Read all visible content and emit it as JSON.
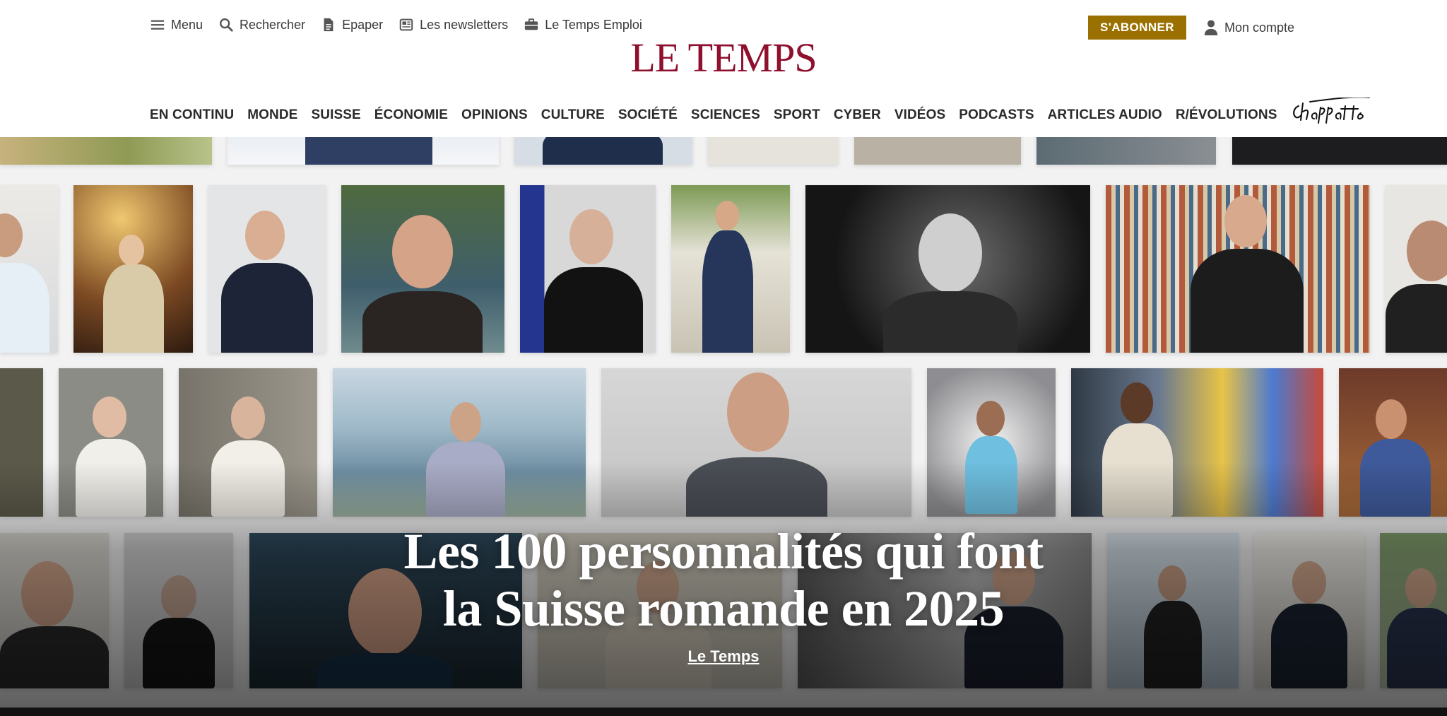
{
  "utility_nav": {
    "menu": "Menu",
    "search": "Rechercher",
    "epaper": "Epaper",
    "newsletters": "Les newsletters",
    "jobs": "Le Temps Emploi"
  },
  "account": {
    "subscribe": "S'ABONNER",
    "my_account": "Mon compte"
  },
  "brand": {
    "logo": "LE TEMPS",
    "color": "#8e0f2e",
    "subscribe_color": "#9a7100"
  },
  "main_nav": [
    "EN CONTINU",
    "MONDE",
    "SUISSE",
    "ÉCONOMIE",
    "OPINIONS",
    "CULTURE",
    "SOCIÉTÉ",
    "SCIENCES",
    "SPORT",
    "CYBER",
    "VIDÉOS",
    "PODCASTS",
    "ARTICLES AUDIO",
    "R/ÉVOLUTIONS"
  ],
  "hero": {
    "headline_line1": "Les 100 personnalités qui font",
    "headline_line2": "la Suisse romande en 2025",
    "byline": "Le Temps"
  }
}
